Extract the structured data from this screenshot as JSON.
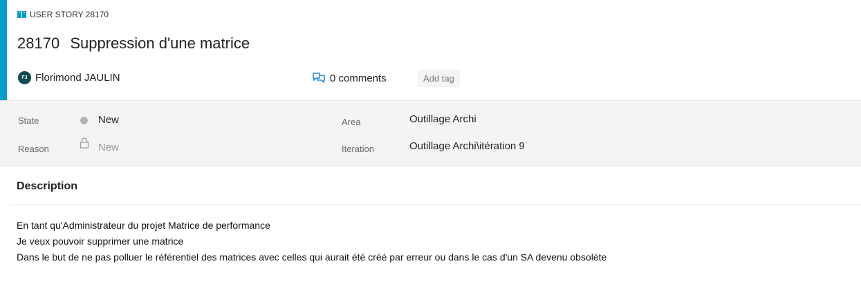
{
  "work_item": {
    "type_label": "USER STORY 28170",
    "id": "28170",
    "title": "Suppression d'une matrice",
    "accent_color": "#009ccc"
  },
  "owner": {
    "initials": "FJ",
    "name": "Florimond JAULIN"
  },
  "discussion": {
    "comments_label": "0 comments",
    "add_tag_label": "Add tag"
  },
  "fields": {
    "state": {
      "label": "State",
      "value": "New",
      "color": "#b2b2b2"
    },
    "reason": {
      "label": "Reason",
      "value": "New"
    },
    "area": {
      "label": "Area",
      "value": "Outillage Archi"
    },
    "iteration": {
      "label": "Iteration",
      "value": "Outillage Archi\\itération 9"
    }
  },
  "description": {
    "heading": "Description",
    "lines": [
      "En tant qu'Administrateur du projet Matrice de performance",
      "Je veux pouvoir supprimer une matrice",
      "Dans le but de ne pas polluer le référentiel des matrices avec celles qui aurait été créé par erreur ou dans le cas d'un SA devenu obsolète"
    ]
  }
}
